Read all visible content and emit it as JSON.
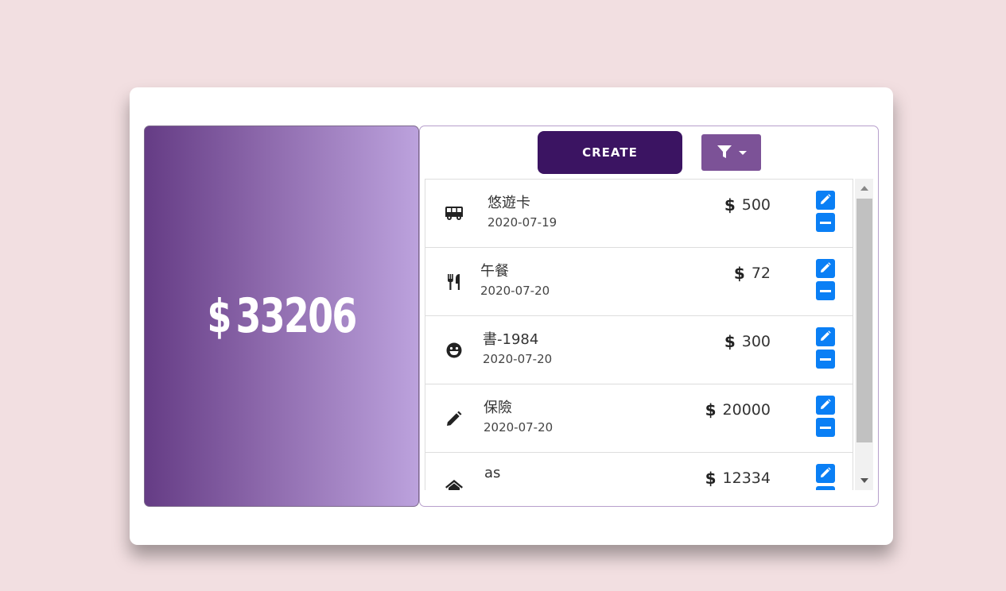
{
  "total": {
    "currency": "$",
    "amount": "33206"
  },
  "toolbar": {
    "create_label": "CREATE"
  },
  "items": [
    {
      "icon": "bus-icon",
      "name": "悠遊卡",
      "date": "2020-07-19",
      "currency": "$",
      "amount": "500"
    },
    {
      "icon": "utensils-icon",
      "name": "午餐",
      "date": "2020-07-20",
      "currency": "$",
      "amount": "72"
    },
    {
      "icon": "grin-icon",
      "name": "書-1984",
      "date": "2020-07-20",
      "currency": "$",
      "amount": "300"
    },
    {
      "icon": "pencil-icon",
      "name": "保險",
      "date": "2020-07-20",
      "currency": "$",
      "amount": "20000"
    },
    {
      "icon": "home-icon",
      "name": "as",
      "date": "",
      "currency": "$",
      "amount": "12334"
    }
  ],
  "colors": {
    "background": "#f2dfe1",
    "create_button": "#3b1462",
    "filter_button": "#7c5297",
    "action_button": "#0a7ff5",
    "gradient_start": "#653c85",
    "gradient_end": "#bca2dd"
  }
}
